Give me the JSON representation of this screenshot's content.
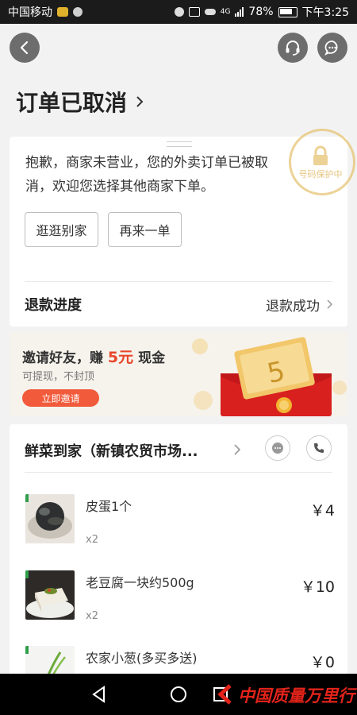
{
  "status_bar": {
    "carrier": "中国移动",
    "signal": "4G",
    "battery": "78%",
    "time": "下午3:25"
  },
  "header": {
    "title": "订单已取消"
  },
  "notice": {
    "text": "抱歉，商家未营业，您的外卖订单已被取消，欢迎您选择其他商家下单。",
    "stamp": "号码保护中",
    "btn_browse": "逛逛别家",
    "btn_reorder": "再来一单"
  },
  "refund": {
    "label": "退款进度",
    "status": "退款成功"
  },
  "promo": {
    "title_prefix": "邀请好友，赚",
    "amount": "5元",
    "title_suffix": "现金",
    "subtitle": "可提现，不封顶",
    "button": "立即邀请",
    "envelope_number": "5"
  },
  "store": {
    "name": "鲜菜到家（新镇农贸市场..."
  },
  "items": [
    {
      "name": "皮蛋1个",
      "qty": "x2",
      "price": "￥4"
    },
    {
      "name": "老豆腐一块约500g",
      "qty": "x2",
      "price": "￥10"
    },
    {
      "name": "农家小葱(多买多送)",
      "qty": "",
      "price": "￥0"
    }
  ],
  "watermark": "中国质量万里行",
  "colors": {
    "accent_red": "#f15a3a",
    "promo_amount": "#e8462b",
    "stamp": "#e8c77c"
  }
}
